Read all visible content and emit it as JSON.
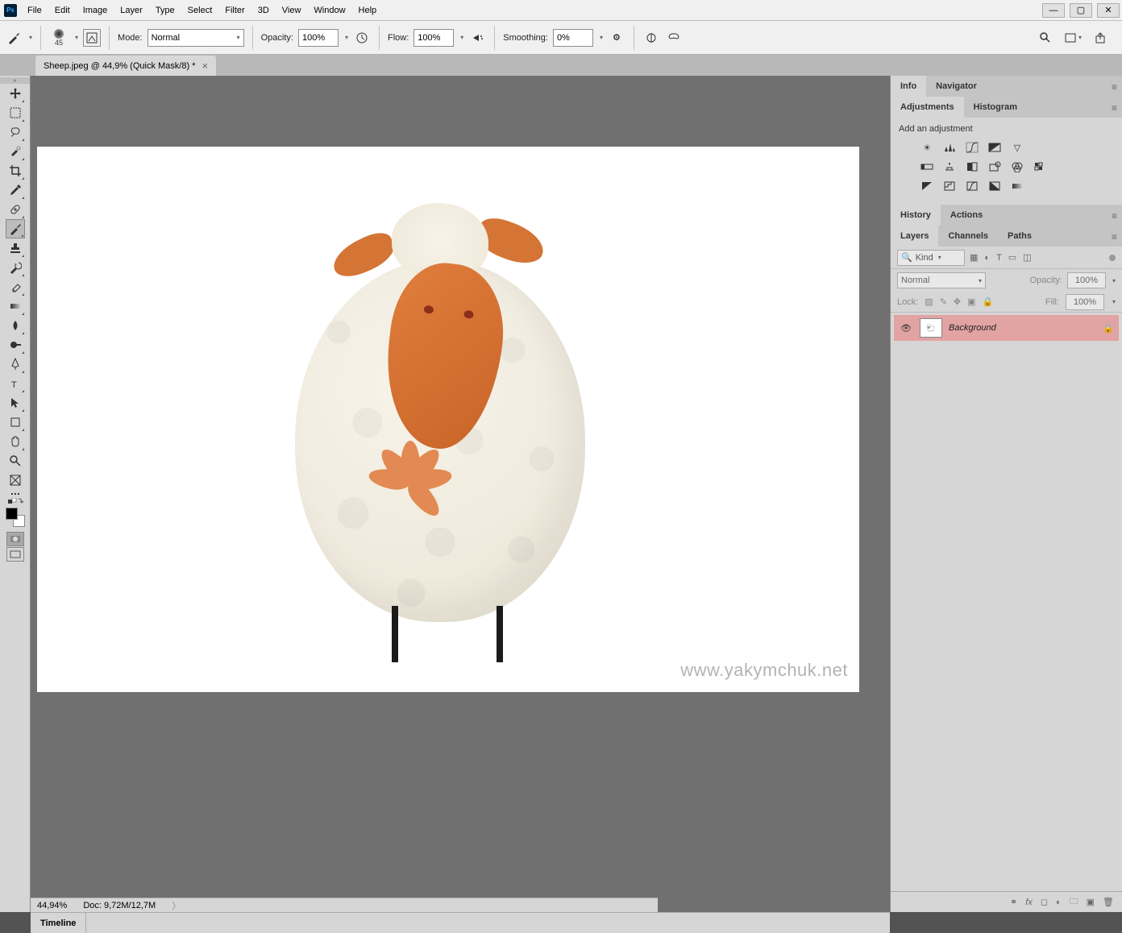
{
  "menu": {
    "items": [
      "File",
      "Edit",
      "Image",
      "Layer",
      "Type",
      "Select",
      "Filter",
      "3D",
      "View",
      "Window",
      "Help"
    ]
  },
  "options": {
    "brush_size": "45",
    "mode_label": "Mode:",
    "mode_value": "Normal",
    "opacity_label": "Opacity:",
    "opacity_value": "100%",
    "flow_label": "Flow:",
    "flow_value": "100%",
    "smoothing_label": "Smoothing:",
    "smoothing_value": "0%"
  },
  "document": {
    "tab_title": "Sheep.jpeg @ 44,9% (Quick Mask/8) *",
    "zoom": "44,94%",
    "doc_size": "Doc: 9,72M/12,7M",
    "watermark": "www.yakymchuk.net"
  },
  "timeline": {
    "label": "Timeline"
  },
  "panels": {
    "info": {
      "tabs": [
        "Info",
        "Navigator"
      ],
      "active": 0
    },
    "adjustments": {
      "tabs": [
        "Adjustments",
        "Histogram"
      ],
      "active": 0,
      "heading": "Add an adjustment"
    },
    "history": {
      "tabs": [
        "History",
        "Actions"
      ],
      "active": 0
    },
    "layers": {
      "tabs": [
        "Layers",
        "Channels",
        "Paths"
      ],
      "active": 0,
      "kind": "Kind",
      "blend": "Normal",
      "opacity_label": "Opacity:",
      "opacity_value": "100%",
      "lock_label": "Lock:",
      "fill_label": "Fill:",
      "fill_value": "100%",
      "layer_name": "Background"
    }
  }
}
